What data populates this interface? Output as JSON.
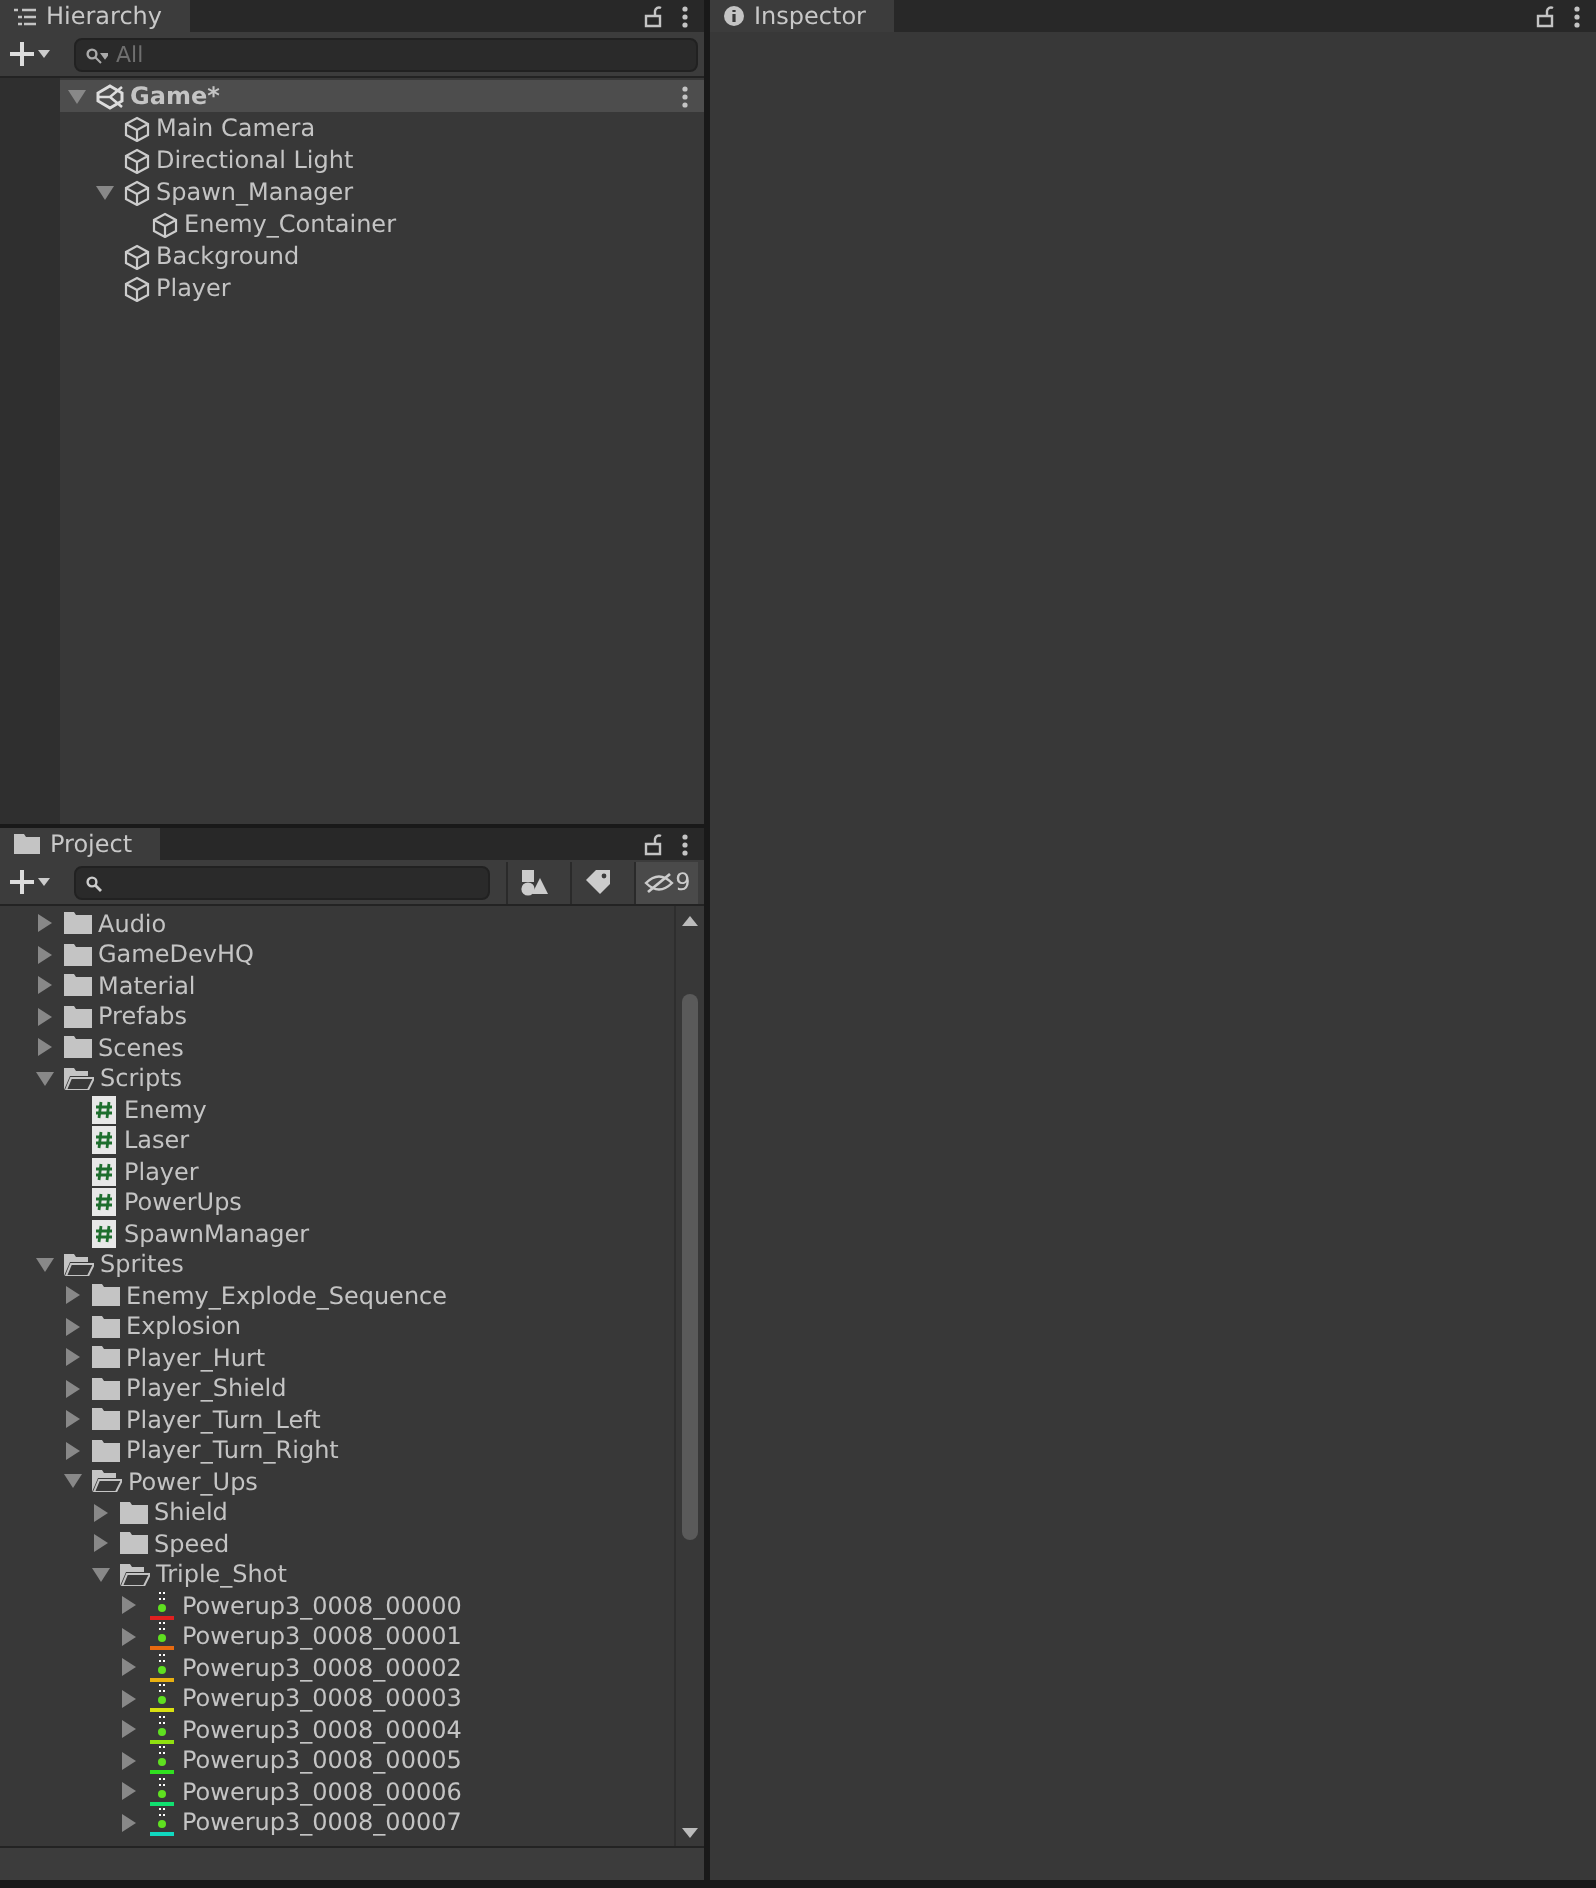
{
  "hierarchy": {
    "tab": "Hierarchy",
    "search": {
      "placeholder": "All"
    },
    "tree": [
      {
        "kind": "scene",
        "label": "Game*",
        "expanded": true,
        "selected": true,
        "children": [
          {
            "kind": "object",
            "label": "Main Camera",
            "selected": false
          },
          {
            "kind": "object",
            "label": "Directional Light",
            "selected": false
          },
          {
            "kind": "object",
            "label": "Spawn_Manager",
            "expanded": true,
            "selected": false,
            "children": [
              {
                "kind": "object",
                "label": "Enemy_Container",
                "selected": false
              }
            ]
          },
          {
            "kind": "object",
            "label": "Background",
            "selected": false
          },
          {
            "kind": "object",
            "label": "Player",
            "selected": false
          }
        ]
      }
    ]
  },
  "project": {
    "tab": "Project",
    "hidden_count": "9",
    "tree": [
      {
        "kind": "folder",
        "label": "Audio",
        "expanded": false
      },
      {
        "kind": "folder",
        "label": "GameDevHQ",
        "expanded": false
      },
      {
        "kind": "folder",
        "label": "Material",
        "expanded": false
      },
      {
        "kind": "folder",
        "label": "Prefabs",
        "expanded": false
      },
      {
        "kind": "folder",
        "label": "Scenes",
        "expanded": false
      },
      {
        "kind": "folder",
        "label": "Scripts",
        "expanded": true,
        "children": [
          {
            "kind": "script",
            "label": "Enemy"
          },
          {
            "kind": "script",
            "label": "Laser"
          },
          {
            "kind": "script",
            "label": "Player"
          },
          {
            "kind": "script",
            "label": "PowerUps"
          },
          {
            "kind": "script",
            "label": "SpawnManager"
          }
        ]
      },
      {
        "kind": "folder",
        "label": "Sprites",
        "expanded": true,
        "children": [
          {
            "kind": "folder",
            "label": "Enemy_Explode_Sequence",
            "expanded": false
          },
          {
            "kind": "folder",
            "label": "Explosion",
            "expanded": false
          },
          {
            "kind": "folder",
            "label": "Player_Hurt",
            "expanded": false
          },
          {
            "kind": "folder",
            "label": "Player_Shield",
            "expanded": false
          },
          {
            "kind": "folder",
            "label": "Player_Turn_Left",
            "expanded": false
          },
          {
            "kind": "folder",
            "label": "Player_Turn_Right",
            "expanded": false
          },
          {
            "kind": "folder",
            "label": "Power_Ups",
            "expanded": true,
            "children": [
              {
                "kind": "folder",
                "label": "Shield",
                "expanded": false
              },
              {
                "kind": "folder",
                "label": "Speed",
                "expanded": false
              },
              {
                "kind": "folder",
                "label": "Triple_Shot",
                "expanded": true,
                "children": [
                  {
                    "kind": "sprite",
                    "label": "Powerup3_0008_00000",
                    "expanded": false,
                    "color": "#e02020"
                  },
                  {
                    "kind": "sprite",
                    "label": "Powerup3_0008_00001",
                    "expanded": false,
                    "color": "#e86a10"
                  },
                  {
                    "kind": "sprite",
                    "label": "Powerup3_0008_00002",
                    "expanded": false,
                    "color": "#e8b010"
                  },
                  {
                    "kind": "sprite",
                    "label": "Powerup3_0008_00003",
                    "expanded": false,
                    "color": "#d8e010"
                  },
                  {
                    "kind": "sprite",
                    "label": "Powerup3_0008_00004",
                    "expanded": false,
                    "color": "#90e010"
                  },
                  {
                    "kind": "sprite",
                    "label": "Powerup3_0008_00005",
                    "expanded": false,
                    "color": "#30e020"
                  },
                  {
                    "kind": "sprite",
                    "label": "Powerup3_0008_00006",
                    "expanded": false,
                    "color": "#10e070"
                  },
                  {
                    "kind": "sprite",
                    "label": "Powerup3_0008_00007",
                    "expanded": false,
                    "color": "#10d8c0"
                  }
                ]
              }
            ]
          }
        ]
      }
    ]
  },
  "inspector": {
    "tab": "Inspector"
  }
}
